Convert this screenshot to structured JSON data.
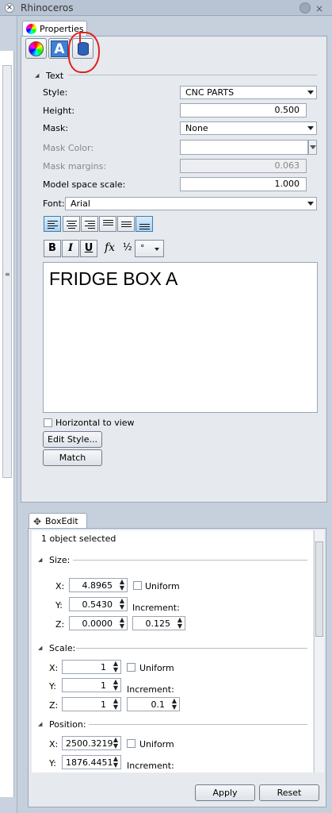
{
  "window": {
    "title": "Rhinoceros",
    "close_icon": "close-icon"
  },
  "properties": {
    "tab_label": "Properties",
    "toolbar": [
      "color-wheel-icon",
      "text-properties-icon",
      "database-icon"
    ],
    "text_group": "Text",
    "style": {
      "label": "Style:",
      "value": "CNC PARTS"
    },
    "height": {
      "label": "Height:",
      "value": "0.500"
    },
    "mask": {
      "label": "Mask:",
      "value": "None"
    },
    "mask_color": {
      "label": "Mask Color:",
      "value": ""
    },
    "mask_margins": {
      "label": "Mask margins:",
      "value": "0.063"
    },
    "model_space_scale": {
      "label": "Model space scale:",
      "value": "1.000"
    },
    "font": {
      "label": "Font:",
      "value": "Arial"
    },
    "format": {
      "bold": "B",
      "italic": "I",
      "underline": "U",
      "fx": "fx",
      "fraction": "½",
      "degree": "°"
    },
    "text_content": "FRIDGE BOX A",
    "horizontal_to_view": "Horizontal to view",
    "edit_style_button": "Edit Style...",
    "match_button": "Match"
  },
  "boxedit": {
    "tab_label": "BoxEdit",
    "selection": "1 object selected",
    "size": {
      "title": "Size:",
      "x": "4.8965",
      "y": "0.5430",
      "z": "0.0000",
      "uniform": "Uniform",
      "increment_label": "Increment:",
      "increment": "0.125"
    },
    "scale": {
      "title": "Scale:",
      "x": "1",
      "y": "1",
      "z": "1",
      "uniform": "Uniform",
      "increment_label": "Increment:",
      "increment": "0.1"
    },
    "position": {
      "title": "Position:",
      "x": "2500.3219",
      "y": "1876.4451",
      "uniform": "Uniform",
      "increment_label": "Increment:"
    },
    "labels": {
      "x": "X:",
      "y": "Y:",
      "z": "Z:"
    },
    "apply_button": "Apply",
    "reset_button": "Reset"
  }
}
